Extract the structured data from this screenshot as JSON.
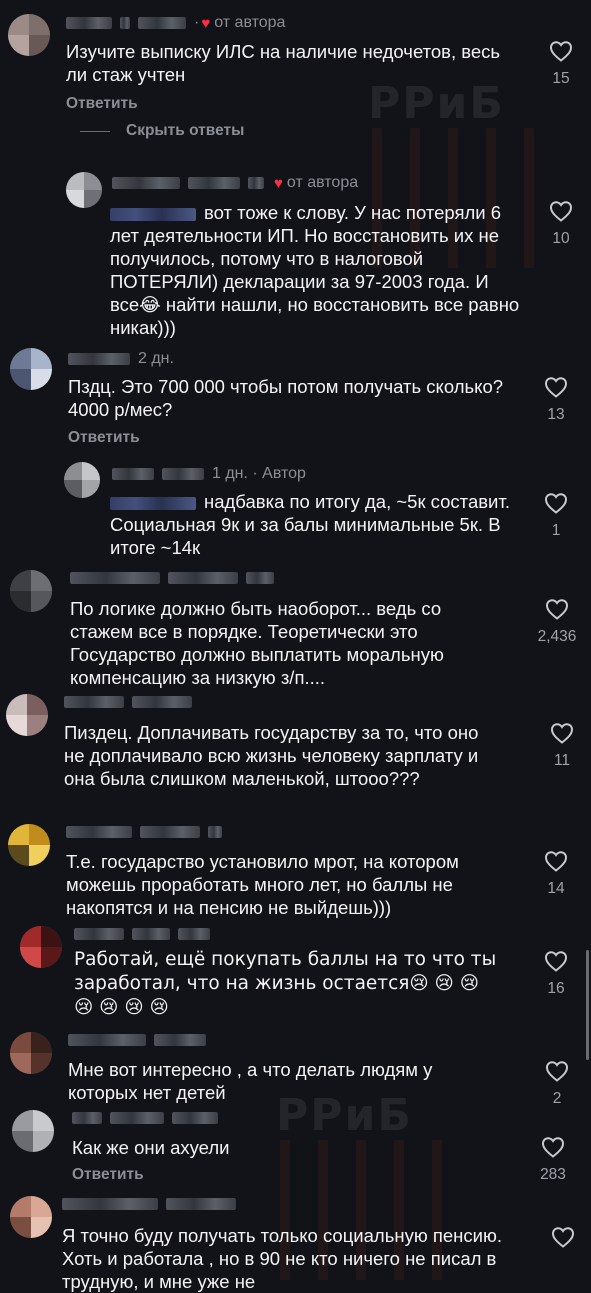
{
  "watermark": {
    "text": "РРиБ"
  },
  "comments": [
    {
      "author_meta": "· ",
      "badge": "от автора",
      "text": "Изучите выписку ИЛС на наличие недочетов, весь ли стаж учтен",
      "reply_label": "Ответить",
      "hide_replies_label": "Скрыть ответы",
      "likes": "15",
      "avatar_colors": [
        "#9b8a86",
        "#7e6e6c",
        "#b5a39f",
        "#6a5856"
      ]
    },
    {
      "author_meta": "",
      "badge": "от автора",
      "mention": "",
      "text": "вот тоже к слову. У нас потеряли 6 лет деятельности ИП. Но восстановить их не получилось, потому что в налоговой ПОТЕРЯЛИ) декларации за 97-2003 года. И все😂 найти нашли, но восстановить все равно никак)))",
      "likes": "10",
      "avatar_colors": [
        "#bbbcc0",
        "#8d8e94",
        "#d8d9dc",
        "#6f7076"
      ]
    },
    {
      "author_meta": "2 дн.",
      "text": "Пздц. Это 700 000 чтобы потом получать сколько? 4000 р/мес?",
      "reply_label": "Ответить",
      "likes": "13",
      "avatar_colors": [
        "#6e7a95",
        "#a7b4cc",
        "#4c5670",
        "#d8dde8"
      ]
    },
    {
      "author_meta": "1 дн. · Автор",
      "text": "надбавка по итогу да, ~5к составит. Социальная 9к и за балы минимальные 5к. В итоге ~14к",
      "likes": "1",
      "avatar_colors": [
        "#8d8e92",
        "#c5c6ca",
        "#5c5d62",
        "#a3a4a8"
      ]
    },
    {
      "author_meta": "",
      "text": "По логике должно быть наоборот... ведь со стажем все в порядке. Теоретически это Государство должно выплатить моральную компенсацию за низкую з/п....",
      "likes": "2,436",
      "avatar_colors": [
        "#3e4046",
        "#6c6e74",
        "#2b2c30",
        "#55575d"
      ]
    },
    {
      "author_meta": "",
      "text": "Пиздец. Доплачивать государству за то, что оно не доплачивало всю жизнь человеку зарплату и она была слишком маленькой, штооо???",
      "likes": "11",
      "avatar_colors": [
        "#cbbcbc",
        "#7b5e5e",
        "#e5d9d9",
        "#9c8080"
      ]
    },
    {
      "author_meta": "",
      "text": "Т.е. государство установило мрот, на котором можешь проработать много лет, но баллы не накопятся и на пенсию не выйдешь)))",
      "likes": "14",
      "avatar_colors": [
        "#e0b63a",
        "#c08d1c",
        "#5a4a1e",
        "#f0cf5c"
      ]
    },
    {
      "author_meta": "",
      "text": "Работай, ещё покупать баллы на то что ты заработал, что на жизнь остается😢 😢 😢 😢 😢 😢 😢",
      "likes": "16",
      "avatar_colors": [
        "#a02a2a",
        "#3c1212",
        "#d04848",
        "#5a1818"
      ]
    },
    {
      "author_meta": "",
      "text": "Мне вот интересно , а что делать людям у которых нет детей",
      "likes": "2",
      "avatar_colors": [
        "#7a4a3e",
        "#3a221c",
        "#a0685a",
        "#55332b"
      ]
    },
    {
      "author_meta": "",
      "text": "Как же они ахуели",
      "reply_label": "Ответить",
      "likes": "283",
      "avatar_colors": [
        "#9a9ba0",
        "#c9cace",
        "#6b6c71",
        "#b0b1b5"
      ]
    },
    {
      "author_meta": "",
      "text": "Я точно буду получать только социальную пенсию. Хоть и работала , но в 90 не кто ничего не писал в трудную, и мне уже не",
      "avatar_colors": [
        "#b47b6a",
        "#d8a894",
        "#7a4f42",
        "#e6c2b2"
      ]
    }
  ]
}
